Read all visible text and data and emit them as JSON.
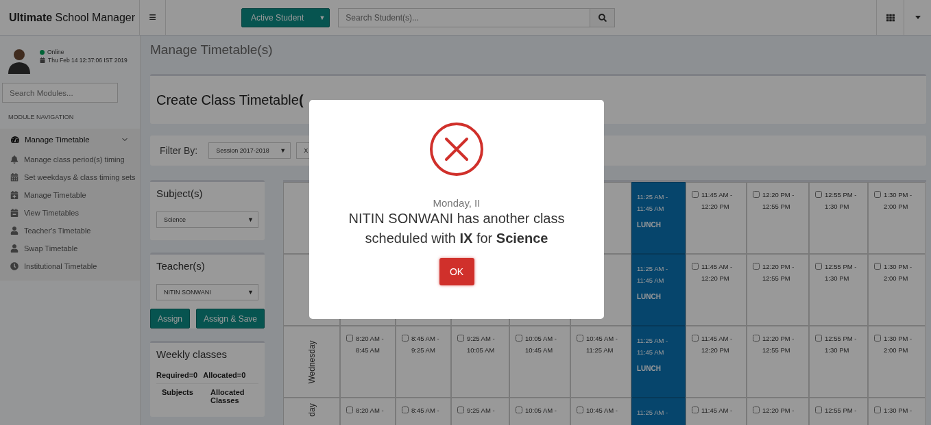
{
  "topbar": {
    "brand": "**Ultimate** School Manager",
    "menu_glyph": "≡",
    "filter_button": {
      "label": "Active Student",
      "caret": "▼"
    },
    "search": {
      "placeholder": "Search Student(s)..."
    }
  },
  "sidebar": {
    "status": "Online",
    "datetime": "Thu Feb 14 12:37:06 IST 2019",
    "search": {
      "placeholder": "Search Modules..."
    },
    "section_title": "MODULE NAVIGATION",
    "group": {
      "label": "Manage Timetable",
      "expanded": true,
      "items": [
        {
          "label": "Manage class period(s) timing"
        },
        {
          "label": "Set weekdays & class timing sets"
        },
        {
          "label": "Manage Timetable"
        },
        {
          "label": "View Timetables"
        },
        {
          "label": "Teacher's Timetable"
        },
        {
          "label": "Swap Timetable"
        },
        {
          "label": "Institutional Timetable"
        }
      ]
    }
  },
  "page_title": "Manage Timetable(s)",
  "header_card": {
    "title": "Create Class Timetable**(**"
  },
  "filter": {
    "label": "Filter By:",
    "selects": [
      {
        "value": "Session 2017-2018",
        "caret": "▼"
      },
      {
        "value": "X"
      }
    ]
  },
  "subject_panel": {
    "title": "Subject(s)",
    "select": {
      "value": "Science",
      "caret": "▼"
    }
  },
  "teacher_panel": {
    "title": "Teacher(s)",
    "select": {
      "value": "NITIN SONWANI",
      "caret": "▼"
    },
    "buttons": [
      "Assign",
      "Assign & Save"
    ]
  },
  "weekly_panel": {
    "title": "Weekly classes",
    "required": "Required=0",
    "allocated": "Allocated=0",
    "columns": [
      "Subjects",
      "Allocated Classes"
    ]
  },
  "timetable": {
    "rows": [
      {
        "cells": [
          {
            "kind": "hidden"
          },
          {
            "kind": "hidden"
          },
          {
            "kind": "hidden"
          },
          {
            "kind": "hidden"
          },
          {
            "kind": "hidden"
          },
          {
            "kind": "lunch",
            "time": "11:25 AM - 11:45 AM",
            "label": "LUNCH"
          },
          {
            "kind": "period",
            "time": "11:45 AM - 12:20 PM",
            "checked": false
          },
          {
            "kind": "period",
            "time": "12:20 PM - 12:55 PM",
            "checked": false
          },
          {
            "kind": "period",
            "time": "12:55 PM - 1:30 PM",
            "checked": false
          },
          {
            "kind": "period",
            "time": "1:30 PM - 2:00 PM",
            "checked": false
          }
        ]
      },
      {
        "cells": [
          {
            "kind": "hidden"
          },
          {
            "kind": "hidden"
          },
          {
            "kind": "hidden"
          },
          {
            "kind": "hidden"
          },
          {
            "kind": "hidden"
          },
          {
            "kind": "lunch",
            "time": "11:25 AM - 11:45 AM",
            "label": "LUNCH"
          },
          {
            "kind": "period",
            "time": "11:45 AM - 12:20 PM",
            "checked": false
          },
          {
            "kind": "period",
            "time": "12:20 PM - 12:55 PM",
            "checked": false
          },
          {
            "kind": "period",
            "time": "12:55 PM - 1:30 PM",
            "checked": false
          },
          {
            "kind": "period",
            "time": "1:30 PM - 2:00 PM",
            "checked": false
          }
        ]
      },
      {
        "day": "Wednesday",
        "cells": [
          {
            "kind": "period",
            "time": "8:20 AM - 8:45 AM",
            "checked": false
          },
          {
            "kind": "period",
            "time": "8:45 AM - 9:25 AM",
            "checked": false
          },
          {
            "kind": "period",
            "time": "9:25 AM - 10:05 AM",
            "checked": false
          },
          {
            "kind": "period",
            "time": "10:05 AM - 10:45 AM",
            "checked": false
          },
          {
            "kind": "period",
            "time": "10:45 AM - 11:25 AM",
            "checked": false
          },
          {
            "kind": "lunch",
            "time": "11:25 AM - 11:45 AM",
            "label": "LUNCH"
          },
          {
            "kind": "period",
            "time": "11:45 AM - 12:20 PM",
            "checked": false
          },
          {
            "kind": "period",
            "time": "12:20 PM - 12:55 PM",
            "checked": false
          },
          {
            "kind": "period",
            "time": "12:55 PM - 1:30 PM",
            "checked": false
          },
          {
            "kind": "period",
            "time": "1:30 PM - 2:00 PM",
            "checked": false
          }
        ]
      },
      {
        "day": "day",
        "cells": [
          {
            "kind": "period",
            "time": "8:20 AM -",
            "checked": false
          },
          {
            "kind": "period",
            "time": "8:45 AM -",
            "checked": false
          },
          {
            "kind": "period",
            "time": "9:25 AM -",
            "checked": false
          },
          {
            "kind": "period",
            "time": "10:05 AM -",
            "checked": false
          },
          {
            "kind": "period",
            "time": "10:45 AM -",
            "checked": false
          },
          {
            "kind": "lunch",
            "time": "11:25 AM -"
          },
          {
            "kind": "period",
            "time": "11:45 AM -",
            "checked": false
          },
          {
            "kind": "period",
            "time": "12:20 PM -",
            "checked": false
          },
          {
            "kind": "period",
            "time": "12:55 PM -",
            "checked": false
          },
          {
            "kind": "period",
            "time": "1:30 PM -",
            "checked": false
          }
        ]
      }
    ]
  },
  "modal": {
    "subtitle": "Monday, II",
    "message": "NITIN SONWANI has another class scheduled with **IX** for **Science**",
    "button": "OK"
  }
}
